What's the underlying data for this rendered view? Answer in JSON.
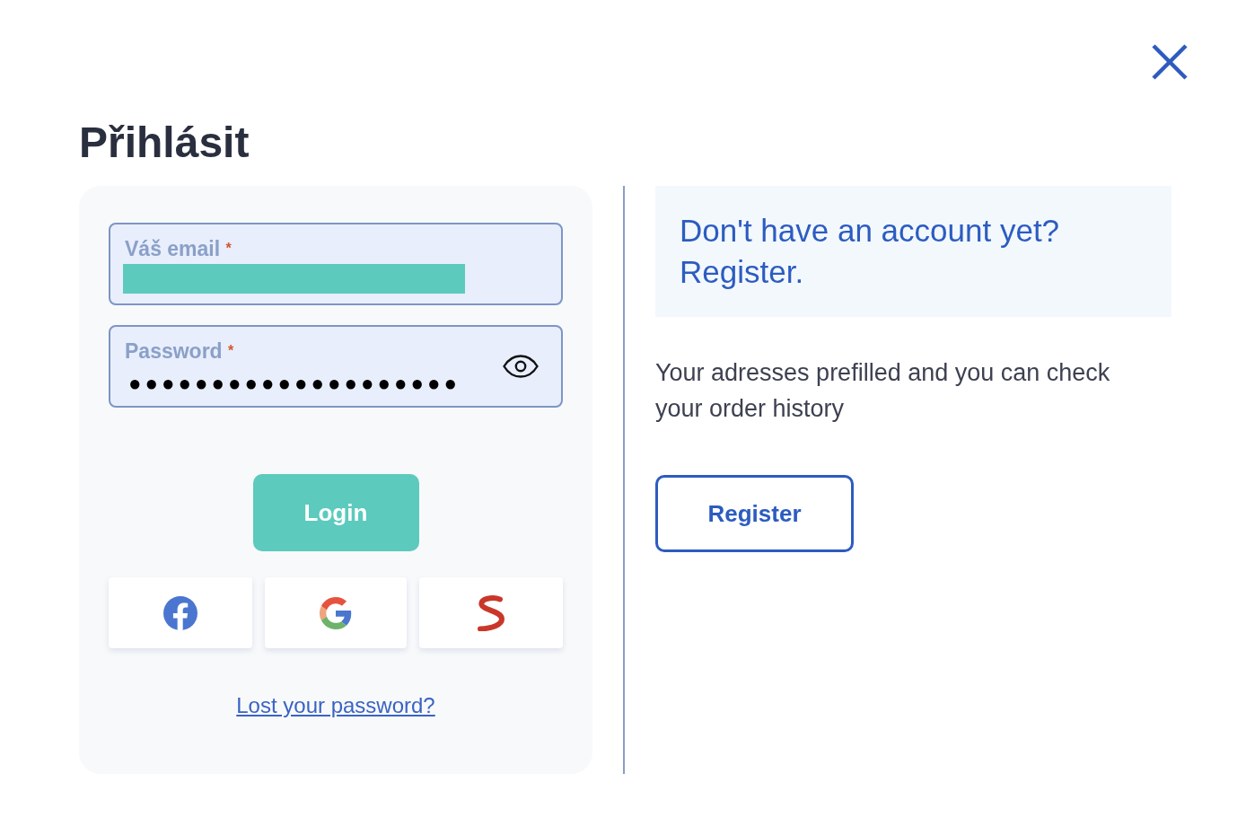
{
  "dialog": {
    "closable": true,
    "title": "Přihlásit"
  },
  "login_form": {
    "fields": [
      {
        "label": "Váš email",
        "required_mark": "*",
        "value_redacted": true
      },
      {
        "label": "Password",
        "required_mark": "*",
        "value": "●●●●●●●●●●●●●●●●●●●●",
        "reveal_toggle": true
      }
    ],
    "submit_button": "Login",
    "social_buttons": [
      {
        "kind": "facebook"
      },
      {
        "kind": "google"
      },
      {
        "kind": "s_logo"
      }
    ],
    "forgot_link": "Lost your password?"
  },
  "register_panel": {
    "heading": "Don't have an account yet? Register.",
    "text": "Your adresses prefilled and you can check your order history",
    "button": "Register"
  }
}
